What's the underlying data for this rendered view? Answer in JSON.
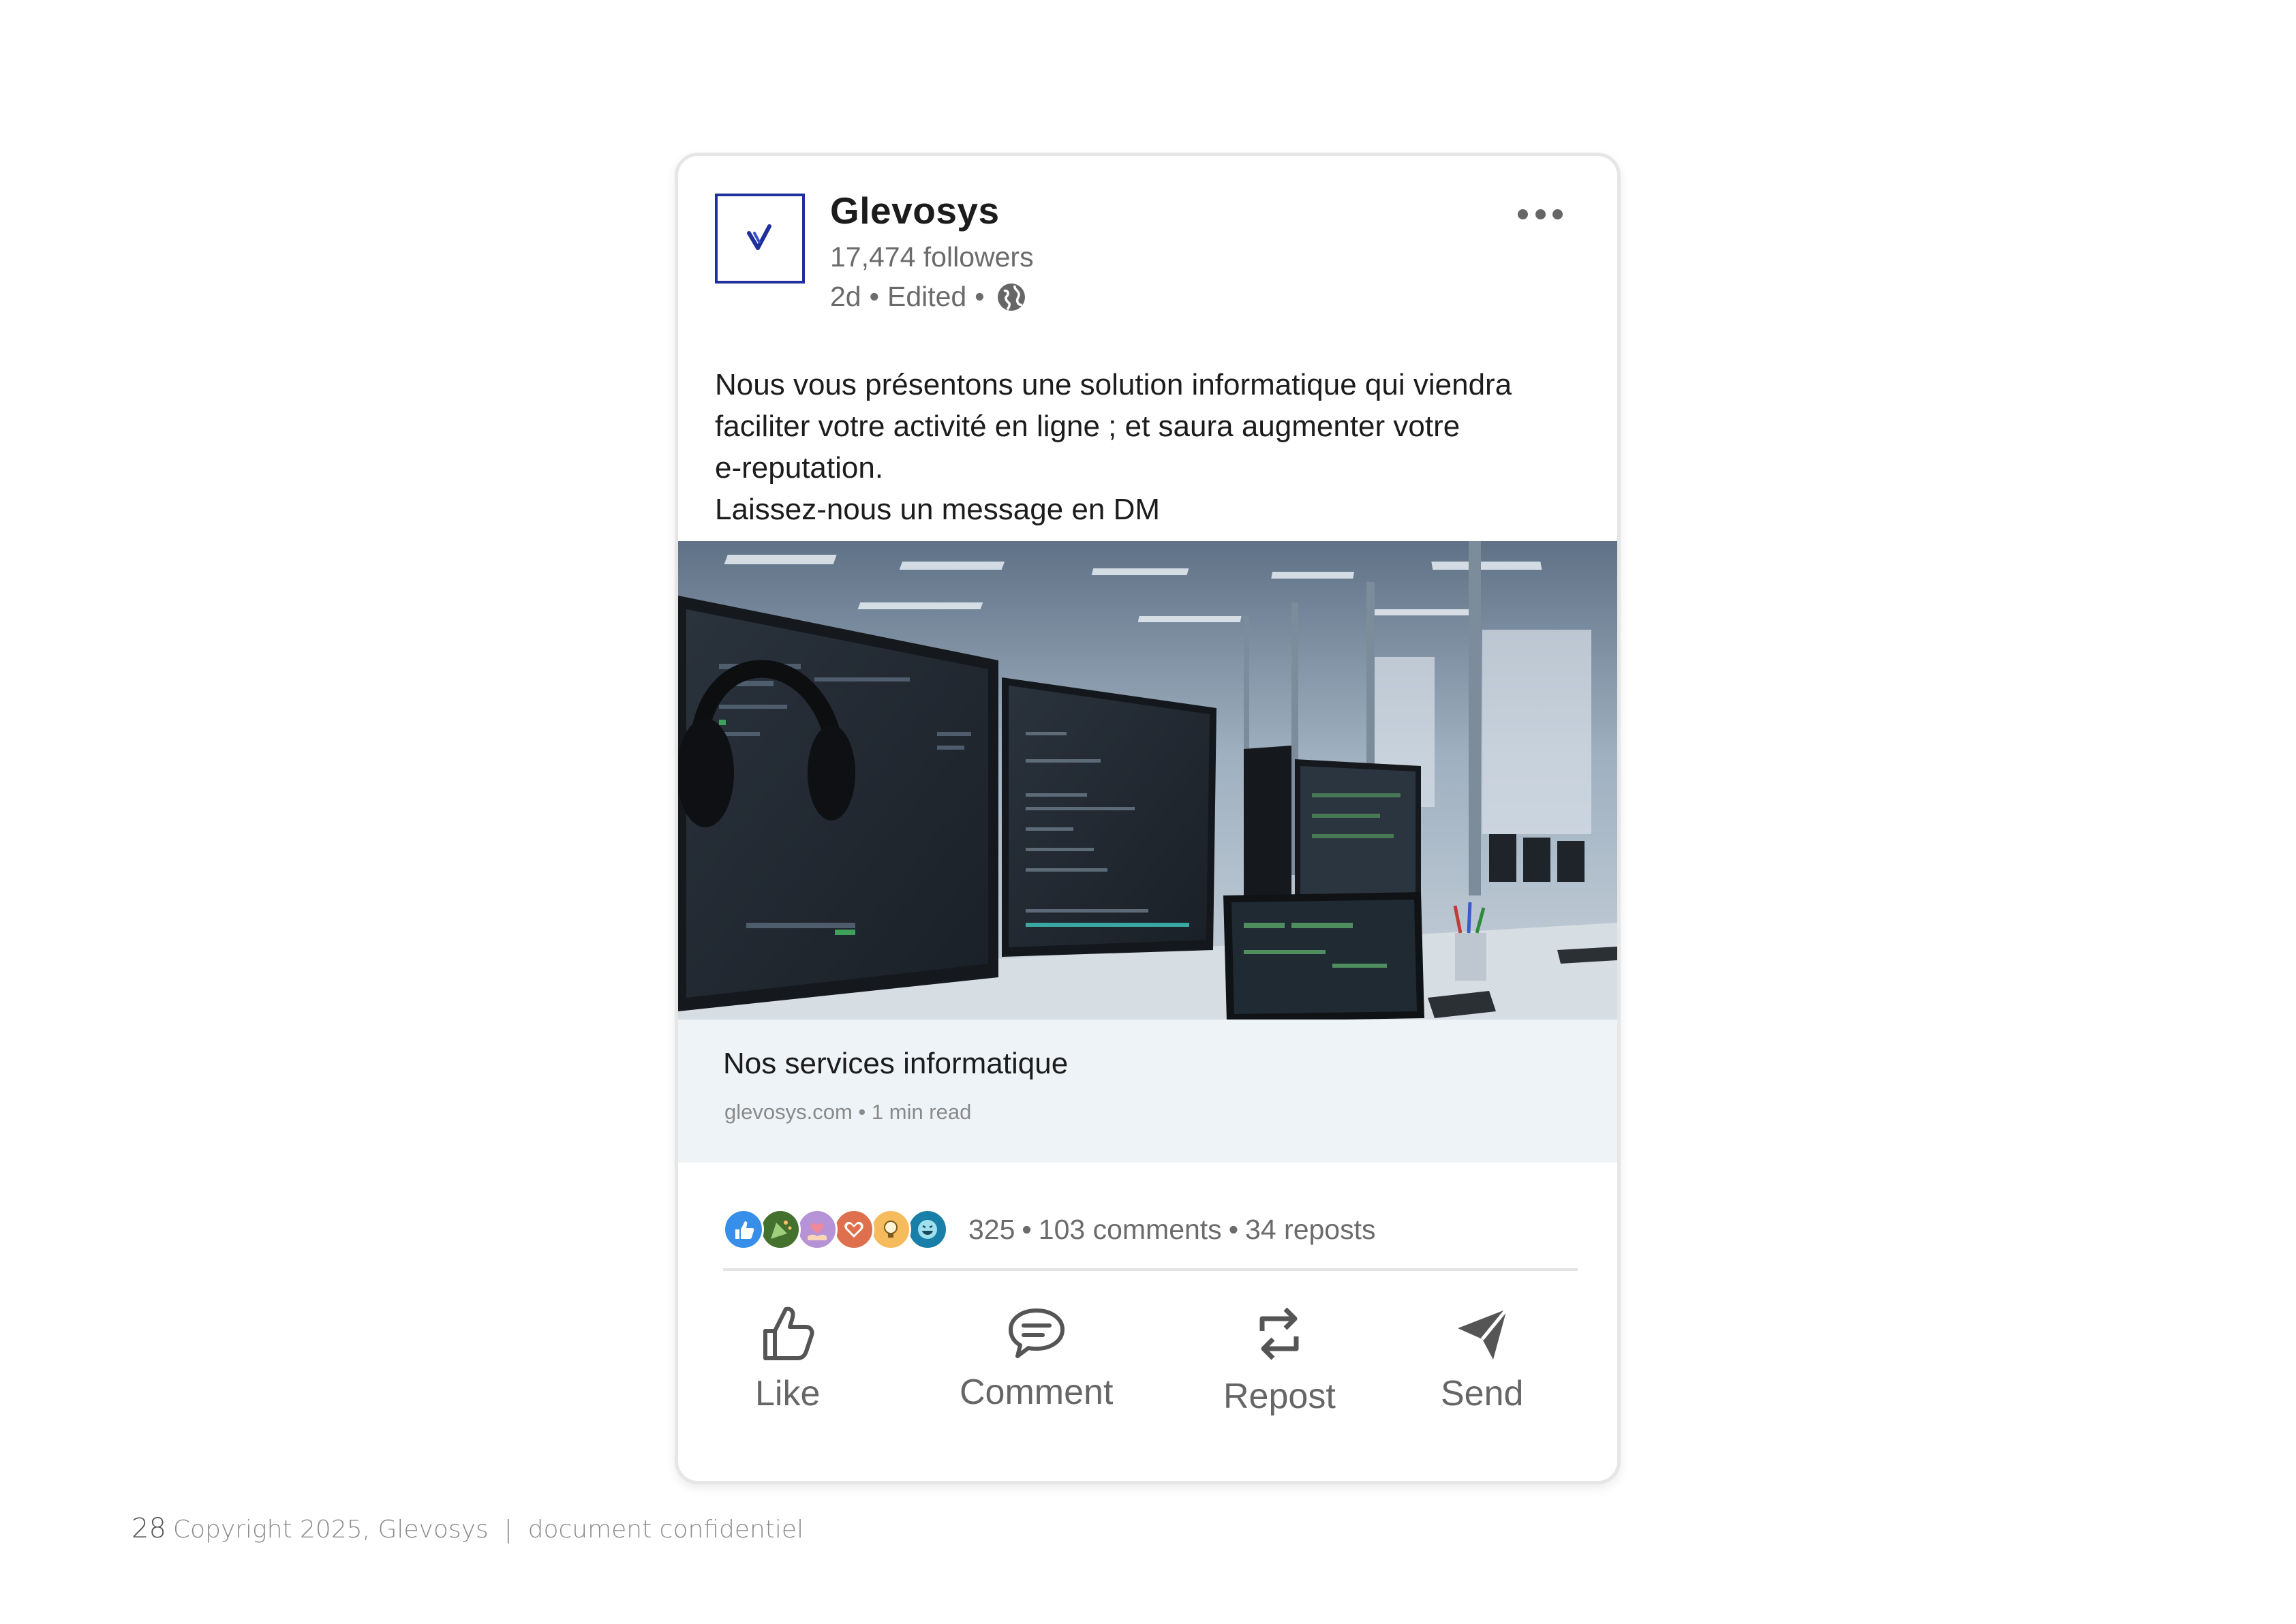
{
  "post": {
    "author": {
      "name": "Glevosys",
      "followers": "17,474 followers",
      "time": "2d",
      "edited": "Edited",
      "visibility_icon": "globe-icon"
    },
    "menu_icon": "more-options-icon",
    "text_lines": [
      "Nous vous présentons une solution informatique qui viendra",
      "faciliter votre activité en ligne ; et saura augmenter votre",
      "e-reputation.",
      "Laissez-nous un message en DM"
    ],
    "image": {
      "subject": "office-workstations-with-monitors"
    },
    "link_preview": {
      "title": "Nos services informatique",
      "domain": "glevosys.com",
      "read_time": "1 min read"
    },
    "reactions": {
      "icons": [
        "like-icon",
        "celebrate-icon",
        "support-icon",
        "love-icon",
        "insightful-icon",
        "funny-icon"
      ],
      "count": "325",
      "comments": "103 comments",
      "reposts": "34 reposts"
    },
    "actions": [
      {
        "label": "Like",
        "icon": "thumbs-up-icon"
      },
      {
        "label": "Comment",
        "icon": "comment-icon"
      },
      {
        "label": "Repost",
        "icon": "repost-icon"
      },
      {
        "label": "Send",
        "icon": "send-icon"
      }
    ]
  },
  "footer": {
    "page_number": "28",
    "text": "Copyright 2025, Glevosys  |  document confidentiel"
  },
  "colors": {
    "brand": "#1f2f9c",
    "preview_bg": "#eef3f8",
    "muted_text": "#6b6b6b"
  }
}
